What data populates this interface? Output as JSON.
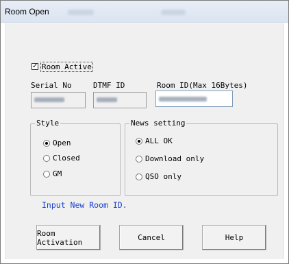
{
  "window": {
    "title": "Room Open"
  },
  "room_active": {
    "label": "Room Active",
    "checked": true,
    "check_glyph": "✓"
  },
  "fields": {
    "serial_no": {
      "label": "Serial No"
    },
    "dtmf_id": {
      "label": "DTMF ID"
    },
    "room_id": {
      "label": "Room ID(Max 16Bytes)"
    }
  },
  "style_group": {
    "legend": "Style",
    "options": [
      {
        "label": "Open",
        "selected": true
      },
      {
        "label": "Closed",
        "selected": false
      },
      {
        "label": "GM",
        "selected": false
      }
    ]
  },
  "news_group": {
    "legend": "News setting",
    "options": [
      {
        "label": "ALL OK",
        "selected": true
      },
      {
        "label": "Download only",
        "selected": false
      },
      {
        "label": "QSO only",
        "selected": false
      }
    ]
  },
  "status_message": "Input New Room ID.",
  "buttons": {
    "activation": "Room Activation",
    "cancel": "Cancel",
    "help": "Help"
  },
  "colors": {
    "status_text": "#1b3fcf",
    "titlebar": "#dbe4f1",
    "dialog_bg": "#f0f0f0"
  }
}
